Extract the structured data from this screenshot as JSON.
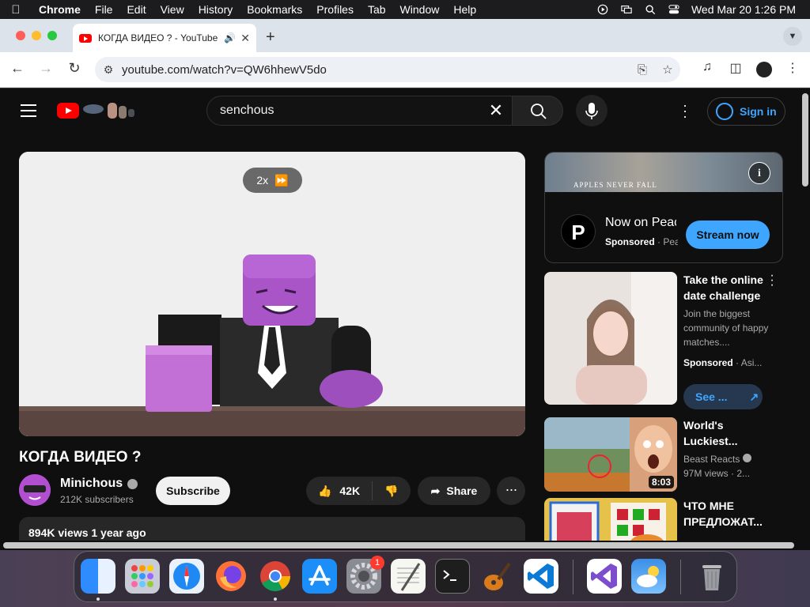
{
  "menubar": {
    "app": "Chrome",
    "items": [
      "File",
      "Edit",
      "View",
      "History",
      "Bookmarks",
      "Profiles",
      "Tab",
      "Window",
      "Help"
    ],
    "datetime": "Wed Mar 20  1:26 PM"
  },
  "browser": {
    "tab_title": "КОГДА ВИДЕО ? - YouTube",
    "new_tab": "+",
    "url": "youtube.com/watch?v=QW6hhewV5do"
  },
  "youtube": {
    "search_query": "senchous",
    "sign_in": "Sign in",
    "player": {
      "speed": "2x"
    },
    "video": {
      "title": "КОГДА ВИДЕО ?",
      "channel": "Minichous",
      "subscribers": "212K subscribers",
      "subscribe": "Subscribe",
      "likes": "42K",
      "share": "Share",
      "views_date": "894K views  1 year ago"
    },
    "ad": {
      "banner_text": "APPLES NEVER FALL",
      "title": "Now on Peacock",
      "sponsored": "Sponsored",
      "advertiser": "Peacock",
      "cta": "Stream now"
    },
    "cards": [
      {
        "title": "Take the online date challenge",
        "desc": "Join the biggest community of happy matches....",
        "sponsored": "Sponsored",
        "source": "Asi...",
        "cta": "See ..."
      },
      {
        "title": "World's Luckiest...",
        "channel": "Beast Reacts",
        "stats": "97M views  ·  2...",
        "duration": "8:03"
      },
      {
        "title": "ЧТО МНЕ ПРЕДЛОЖАТ..."
      }
    ]
  },
  "dock": {
    "apps": [
      "finder-icon",
      "launchpad-icon",
      "safari-icon",
      "firefox-icon",
      "chrome-icon",
      "app-store-icon",
      "system-settings-icon",
      "textedit-icon",
      "terminal-icon",
      "garageband-icon",
      "vscode-icon",
      "visual-studio-icon",
      "weather-icon",
      "trash-icon"
    ],
    "settings_badge": "1"
  }
}
